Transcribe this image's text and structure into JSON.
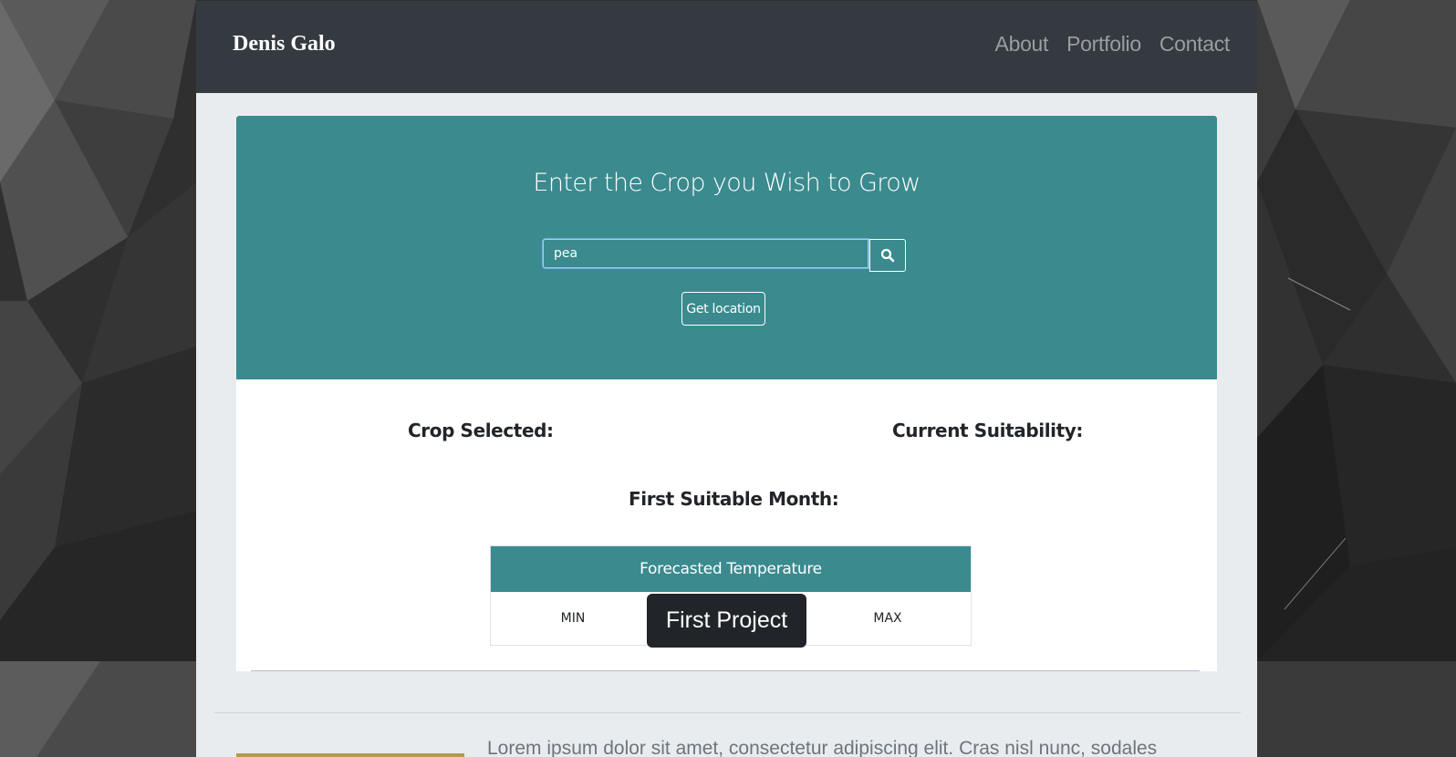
{
  "navbar": {
    "brand": "Denis Galo",
    "links": [
      "About",
      "Portfolio",
      "Contact"
    ]
  },
  "hero": {
    "title": "Enter the Crop you Wish to Grow",
    "search_value": "pea",
    "search_icon": "search-icon",
    "location_button": "Get location"
  },
  "results": {
    "crop_selected_label": "Crop Selected:",
    "current_suitability_label": "Current Suitability:",
    "first_suitable_month_label": "First Suitable Month:"
  },
  "forecast_table": {
    "header": "Forecasted Temperature",
    "columns": [
      "MIN",
      "MAX"
    ]
  },
  "tooltip": "First Project",
  "portfolio": {
    "description": "Lorem ipsum dolor sit amet, consectetur adipiscing elit. Cras nisl nunc, sodales"
  },
  "colors": {
    "navbar": "#343a40",
    "accent": "#3a8a8e",
    "page": "#e9ecef"
  }
}
